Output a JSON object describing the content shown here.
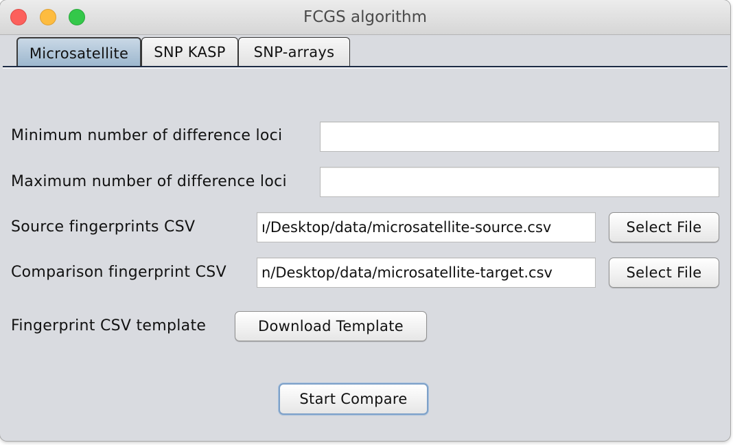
{
  "window": {
    "title": "FCGS algorithm"
  },
  "tabs": [
    {
      "label": "Microsatellite",
      "active": true
    },
    {
      "label": "SNP KASP",
      "active": false
    },
    {
      "label": "SNP-arrays",
      "active": false
    }
  ],
  "form": {
    "min_loci_label": "Minimum number of difference loci",
    "min_loci_value": "",
    "max_loci_label": "Maximum number of difference loci",
    "max_loci_value": "",
    "source_label": "Source fingerprints CSV",
    "source_value": "ı/Desktop/data/microsatellite-source.csv",
    "source_button": "Select File",
    "comparison_label": "Comparison fingerprint CSV",
    "comparison_value": "n/Desktop/data/microsatellite-target.csv",
    "comparison_button": "Select File",
    "template_label": "Fingerprint CSV template",
    "template_button": "Download Template",
    "start_button": "Start Compare"
  },
  "colors": {
    "close": "#fc605c",
    "minimize": "#fdbc40",
    "maximize": "#34c84a",
    "active_tab": "#9bb6cd",
    "background": "#d9dbe0"
  }
}
